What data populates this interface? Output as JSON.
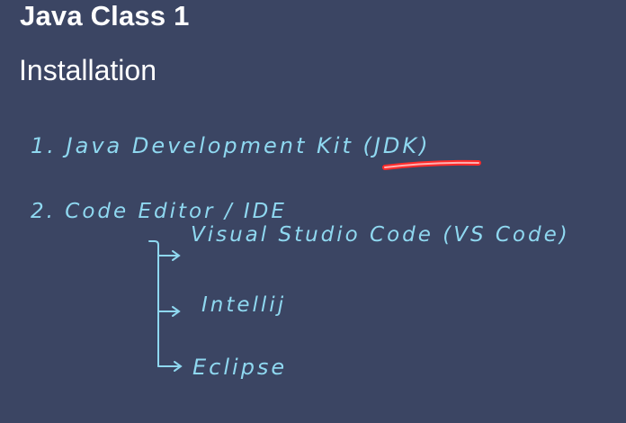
{
  "slide": {
    "title": "Java Class 1",
    "subtitle": "Installation"
  },
  "notes": {
    "item1": "1. Java Development Kit (JDK)",
    "item2": "2. Code Editor / IDE",
    "sub_items": [
      "Visual Studio Code (VS Code)",
      "Intellij",
      "Eclipse"
    ]
  },
  "colors": {
    "background": "#3b4563",
    "text": "#ffffff",
    "ink": "#8fd8f0",
    "highlight": "#ff2020"
  }
}
